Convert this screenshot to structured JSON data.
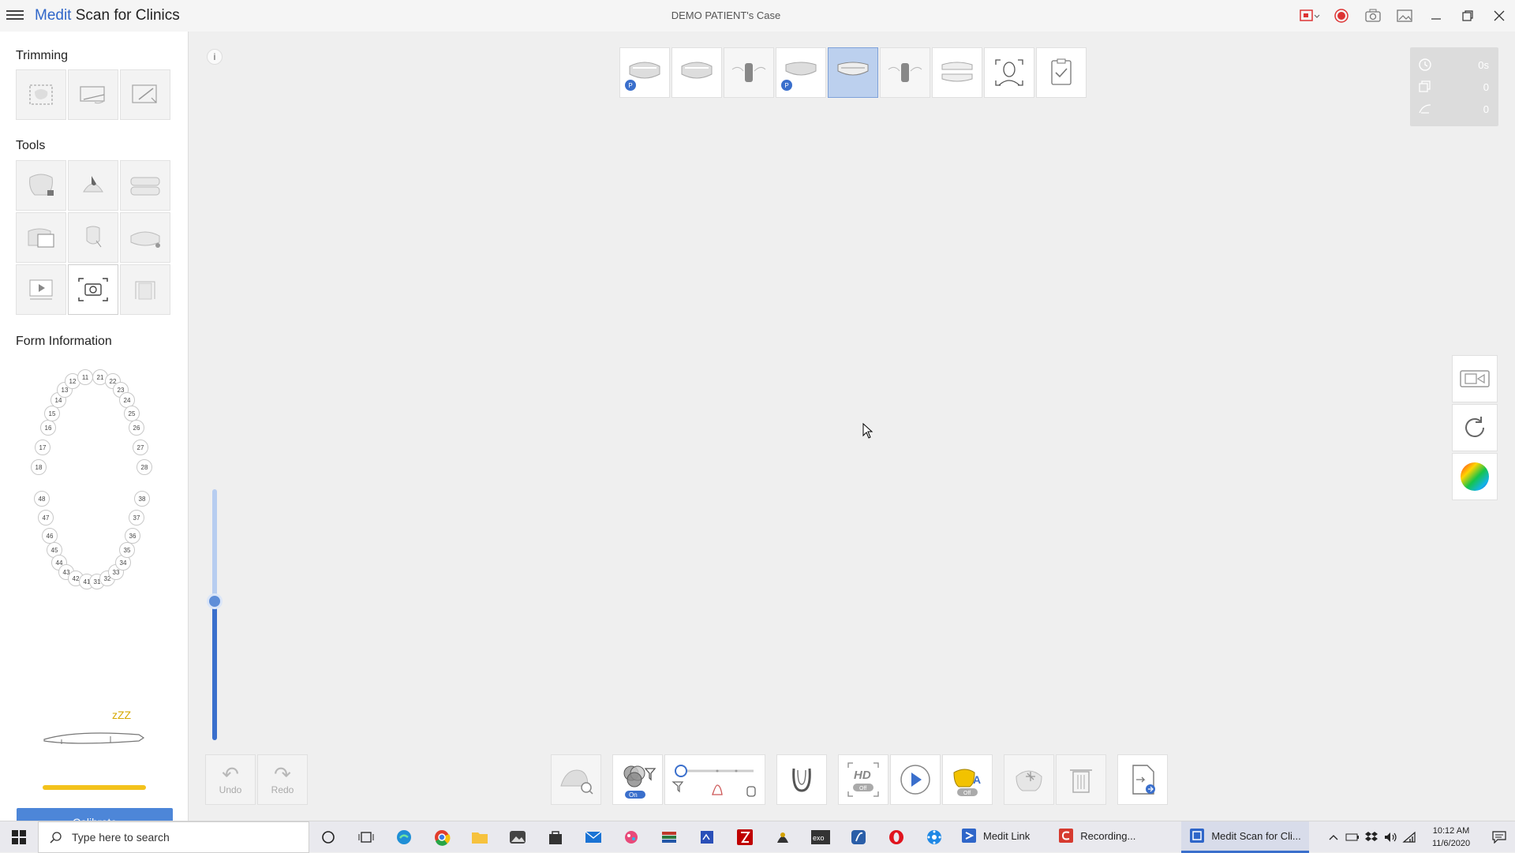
{
  "titlebar": {
    "brand": "Medit",
    "app_rest": " Scan for Clinics",
    "case_title": "DEMO PATIENT's Case"
  },
  "left": {
    "trimming_title": "Trimming",
    "tools_title": "Tools",
    "form_title": "Form Information",
    "sleep_text": "zZZ",
    "calibrate_label": "Calibrate"
  },
  "teeth_upper": [
    "18",
    "17",
    "16",
    "15",
    "14",
    "13",
    "12",
    "11",
    "21",
    "22",
    "23",
    "24",
    "25",
    "26",
    "27",
    "28"
  ],
  "teeth_lower": [
    "48",
    "47",
    "46",
    "45",
    "44",
    "43",
    "42",
    "41",
    "31",
    "32",
    "33",
    "34",
    "35",
    "36",
    "37",
    "38"
  ],
  "workspace": {
    "info_glyph": "i",
    "stats": {
      "time": "0s",
      "shots": "0",
      "frames": "0"
    }
  },
  "controls": {
    "undo_label": "Undo",
    "redo_label": "Redo",
    "filter_toggle": "On",
    "hd_label": "HD",
    "hd_toggle": "Off",
    "ai_toggle": "Off",
    "ai_label": "A"
  },
  "taskbar": {
    "search_placeholder": "Type here to search",
    "tasks": [
      "Medit Link",
      "Recording...",
      "Medit Scan for Cli..."
    ],
    "time": "10:12 AM",
    "date": "11/6/2020"
  },
  "colors": {
    "brand_blue": "#2f66c9",
    "calibrate_bg": "#4d86d8",
    "battery": "#f3c21c",
    "stage_selected": "#bcd0ee"
  }
}
